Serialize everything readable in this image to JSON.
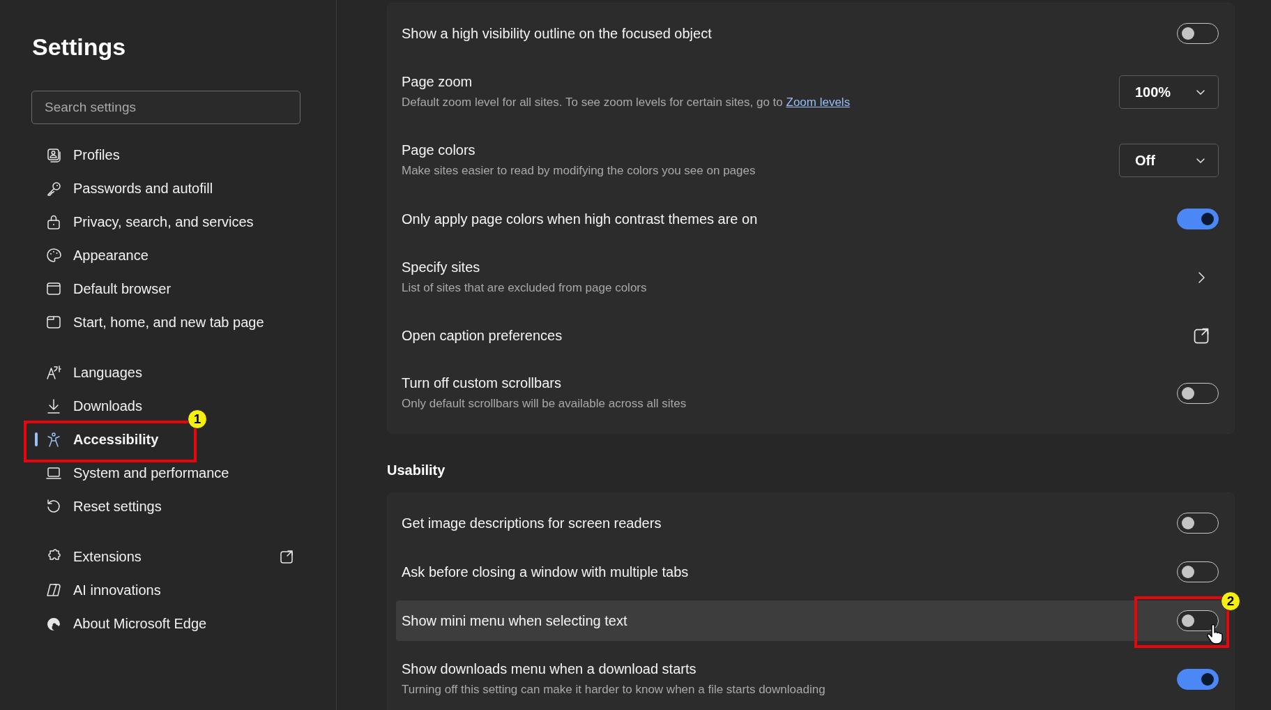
{
  "sidebar": {
    "title": "Settings",
    "search": {
      "placeholder": "Search settings"
    },
    "groups": [
      [
        {
          "label": "Profiles",
          "selected": false
        },
        {
          "label": "Passwords and autofill",
          "selected": false
        },
        {
          "label": "Privacy, search, and services",
          "selected": false
        },
        {
          "label": "Appearance",
          "selected": false
        },
        {
          "label": "Default browser",
          "selected": false
        },
        {
          "label": "Start, home, and new tab page",
          "selected": false
        }
      ],
      [
        {
          "label": "Languages",
          "selected": false
        },
        {
          "label": "Downloads",
          "selected": false
        },
        {
          "label": "Accessibility",
          "selected": true,
          "callout": "1"
        },
        {
          "label": "System and performance",
          "selected": false
        },
        {
          "label": "Reset settings",
          "selected": false
        }
      ],
      [
        {
          "label": "Extensions",
          "selected": false,
          "external": true
        },
        {
          "label": "AI innovations",
          "selected": false
        },
        {
          "label": "About Microsoft Edge",
          "selected": false
        }
      ]
    ]
  },
  "sections": [
    {
      "rows": [
        {
          "kind": "toggle",
          "title": "Show a high visibility outline on the focused object",
          "on": false
        },
        {
          "kind": "dropdown",
          "title": "Page zoom",
          "description": "Default zoom level for all sites. To see zoom levels for certain sites, go to",
          "link": "Zoom levels",
          "value": "100%"
        },
        {
          "kind": "dropdown",
          "title": "Page colors",
          "description": "Make sites easier to read by modifying the colors you see on pages",
          "value": "Off"
        },
        {
          "kind": "toggle",
          "title": "Only apply page colors when high contrast themes are on",
          "on": true
        },
        {
          "kind": "chevron",
          "title": "Specify sites",
          "description": "List of sites that are excluded from page colors"
        },
        {
          "kind": "external",
          "title": "Open caption preferences"
        },
        {
          "kind": "toggle",
          "title": "Turn off custom scrollbars",
          "description": "Only default scrollbars will be available across all sites",
          "on": false
        }
      ]
    },
    {
      "heading": "Usability",
      "rows": [
        {
          "kind": "toggle",
          "title": "Get image descriptions for screen readers",
          "on": false
        },
        {
          "kind": "toggle",
          "title": "Ask before closing a window with multiple tabs",
          "on": false
        },
        {
          "kind": "toggle",
          "title": "Show mini menu when selecting text",
          "on": false,
          "hovered": true,
          "callout": "2"
        },
        {
          "kind": "toggle",
          "title": "Show downloads menu when a download starts",
          "description": "Turning off this setting can make it harder to know when a file starts downloading",
          "on": true
        }
      ]
    }
  ]
}
